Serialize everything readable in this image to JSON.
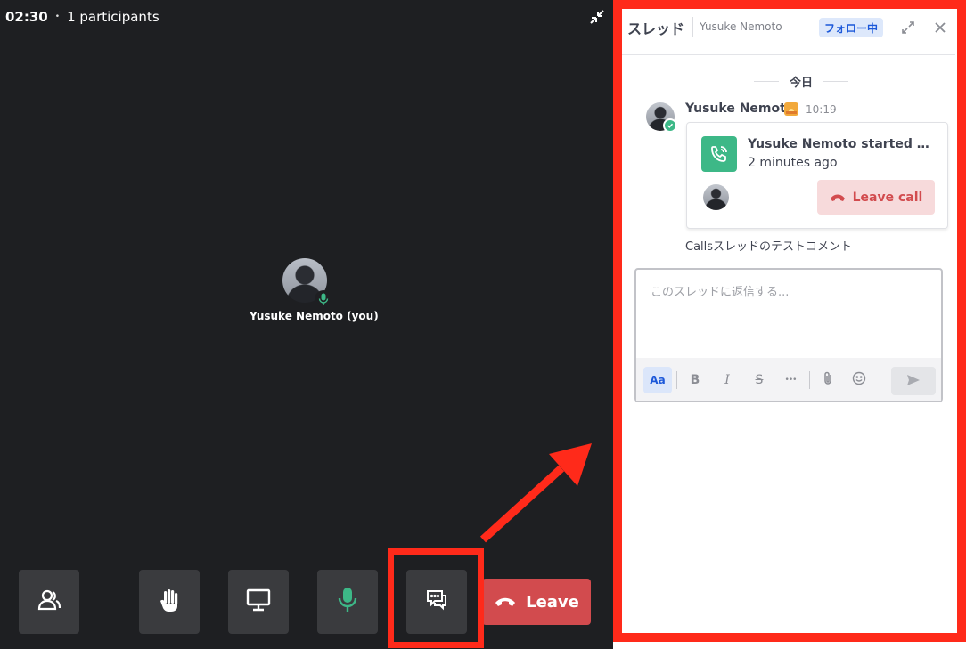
{
  "call": {
    "duration": "02:30",
    "separator": "•",
    "participants": "1 participants",
    "user_label": "Yusuke Nemoto (you)",
    "leave_label": "Leave",
    "colors": {
      "background": "#1e1f22",
      "control": "#3a3b3e",
      "leave": "#d24b4e",
      "mic_active": "#3db887"
    },
    "controls": [
      "participants-icon",
      "raise-hand-icon",
      "screen-share-icon",
      "microphone-icon",
      "chat-thread-icon"
    ]
  },
  "thread": {
    "title": "スレッド",
    "subtitle": "Yusuke Nemoto",
    "follow_label": "フォロー中",
    "date_divider": "今日",
    "post": {
      "author": "Yusuke Nemoto",
      "time": "10:19",
      "call_card": {
        "title": "Yusuke Nemoto started a c...",
        "subtitle": "2 minutes ago",
        "leave_call_label": "Leave call"
      },
      "comment": "Callsスレッドのテストコメント"
    },
    "reply": {
      "placeholder": "このスレッドに返信する...",
      "format_label": "Aa",
      "bold": "B",
      "italic": "I",
      "strike": "S",
      "more": "•••"
    }
  },
  "annotation": {
    "highlight_color": "#ff2a1a"
  }
}
